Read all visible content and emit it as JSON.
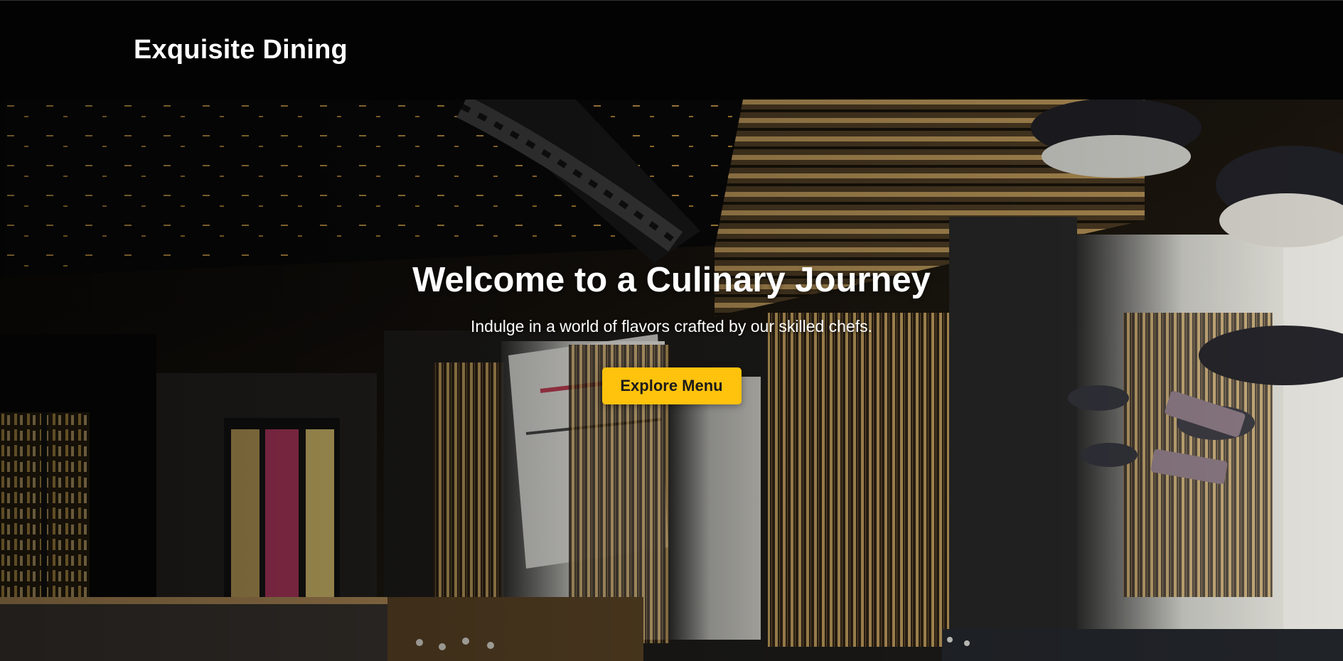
{
  "header": {
    "brand": "Exquisite Dining",
    "background": "#030303"
  },
  "hero": {
    "title": "Welcome to a Culinary Journey",
    "subtitle": "Indulge in a world of flavors crafted by our skilled chefs.",
    "button_label": "Explore Menu",
    "background_image": "restaurant-interior-photo"
  },
  "colors": {
    "accent": "#ffc20d",
    "text": "#ffffff",
    "button_text": "#1b1b1b"
  }
}
